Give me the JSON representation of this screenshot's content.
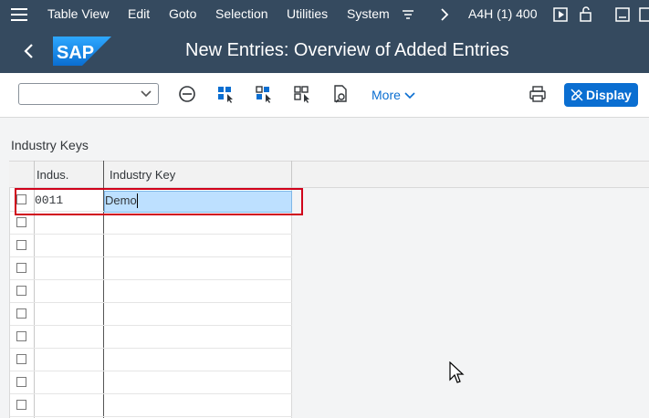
{
  "menubar": {
    "items": [
      "Table View",
      "Edit",
      "Goto",
      "Selection",
      "Utilities",
      "System"
    ],
    "system_info": "A4H (1) 400"
  },
  "header": {
    "logo_text": "SAP",
    "title": "New Entries: Overview of Added Entries"
  },
  "toolbar": {
    "more_label": "More",
    "display_label": "Display"
  },
  "section": {
    "title": "Industry Keys"
  },
  "table": {
    "columns": [
      "Indus.",
      "Industry Key"
    ],
    "rows": [
      {
        "code": "0011",
        "description": "Demo"
      }
    ],
    "empty_rows": 9
  },
  "colors": {
    "shell_bg": "#354a5f",
    "accent": "#0a6ed1",
    "selection": "#bde0ff",
    "highlight_box": "#d0021b"
  }
}
